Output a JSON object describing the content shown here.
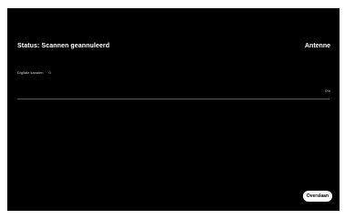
{
  "status": {
    "title": "Status: Scannen geannuleerd",
    "source": "Antenne"
  },
  "scan": {
    "digital_label": "Digitale kanalen",
    "digital_count": "0",
    "percent_text": "0%",
    "progress": 0
  },
  "actions": {
    "skip_label": "Overslaan"
  },
  "colors": {
    "background": "#000000",
    "text": "#ffffff",
    "track": "#5a5a5a"
  }
}
